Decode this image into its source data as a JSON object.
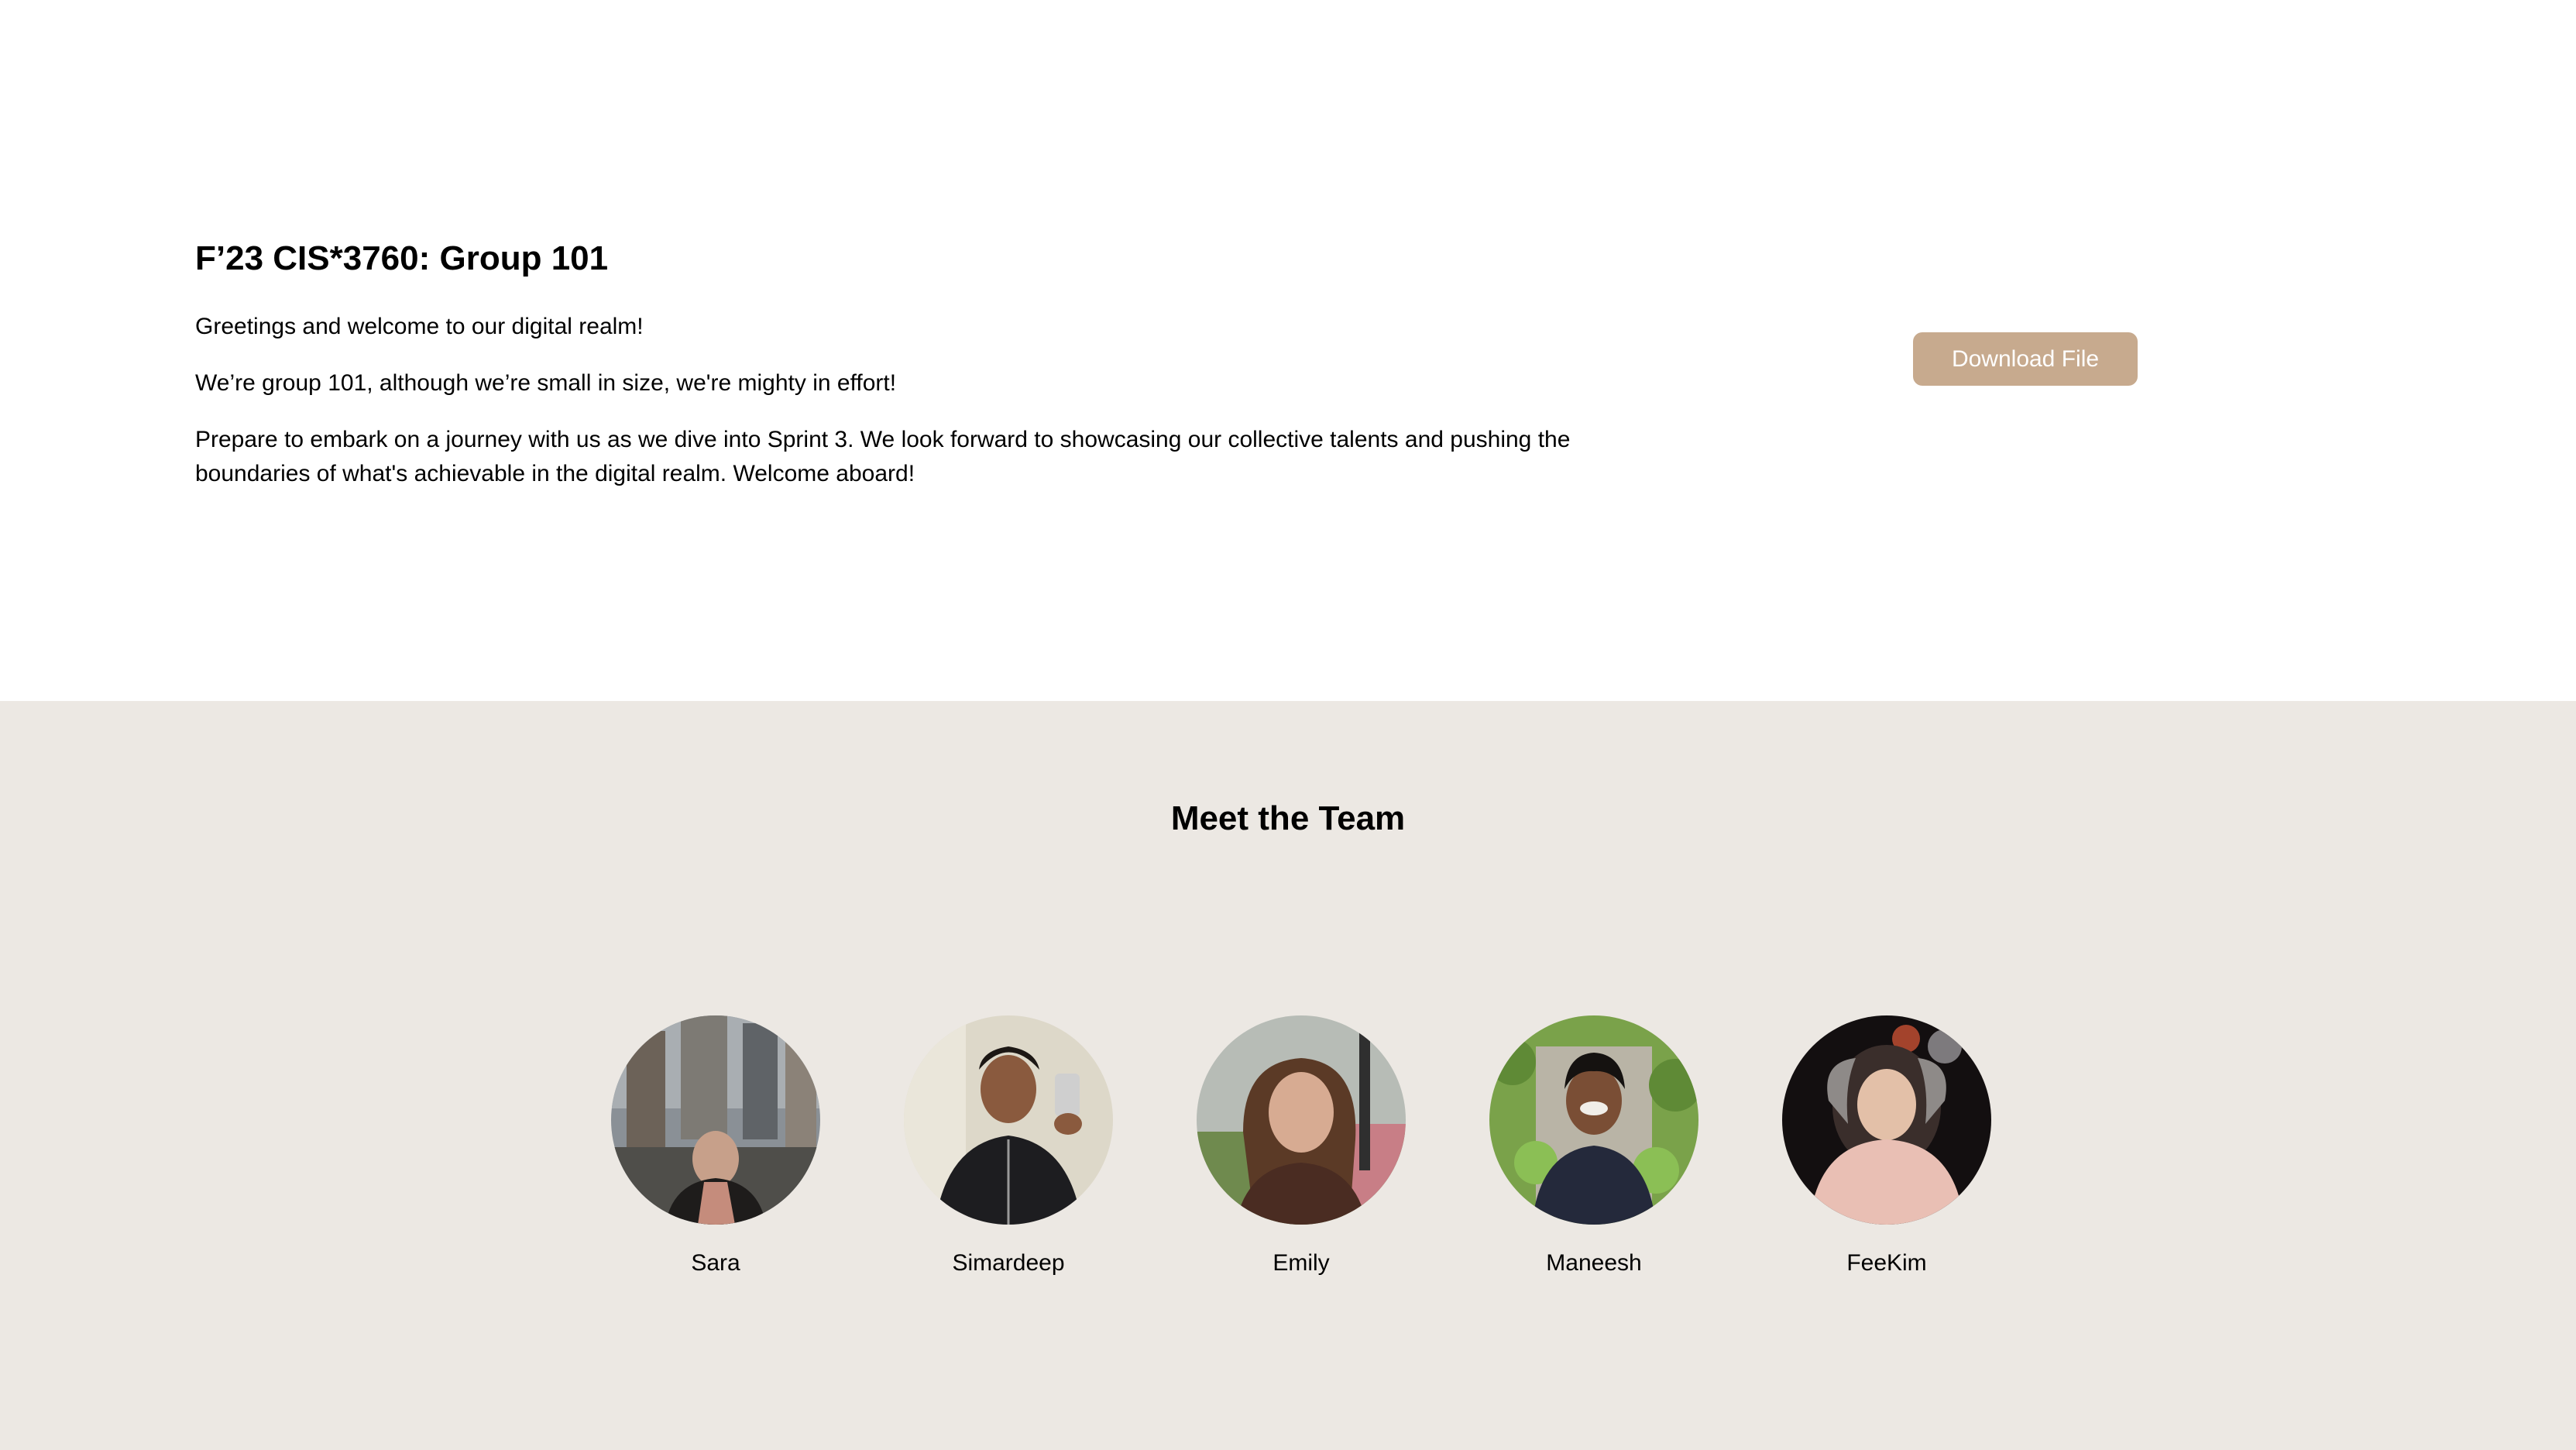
{
  "hero": {
    "title": "F’23 CIS*3760: Group 101",
    "greeting": "Greetings and welcome to our digital realm!",
    "intro": "We’re group 101, although we’re small in size, we're mighty in effort!",
    "description": "Prepare to embark on a journey with us as we dive into Sprint 3. We look forward to showcasing our collective talents and pushing the boundaries of what's achievable in the digital realm. Welcome aboard!",
    "download_label": "Download File"
  },
  "team": {
    "title": "Meet the Team",
    "members": [
      {
        "name": "Sara"
      },
      {
        "name": "Simardeep"
      },
      {
        "name": "Emily"
      },
      {
        "name": "Maneesh"
      },
      {
        "name": "FeeKim"
      }
    ]
  },
  "colors": {
    "button": "#c7aa8e",
    "team_background": "#ece8e3"
  }
}
